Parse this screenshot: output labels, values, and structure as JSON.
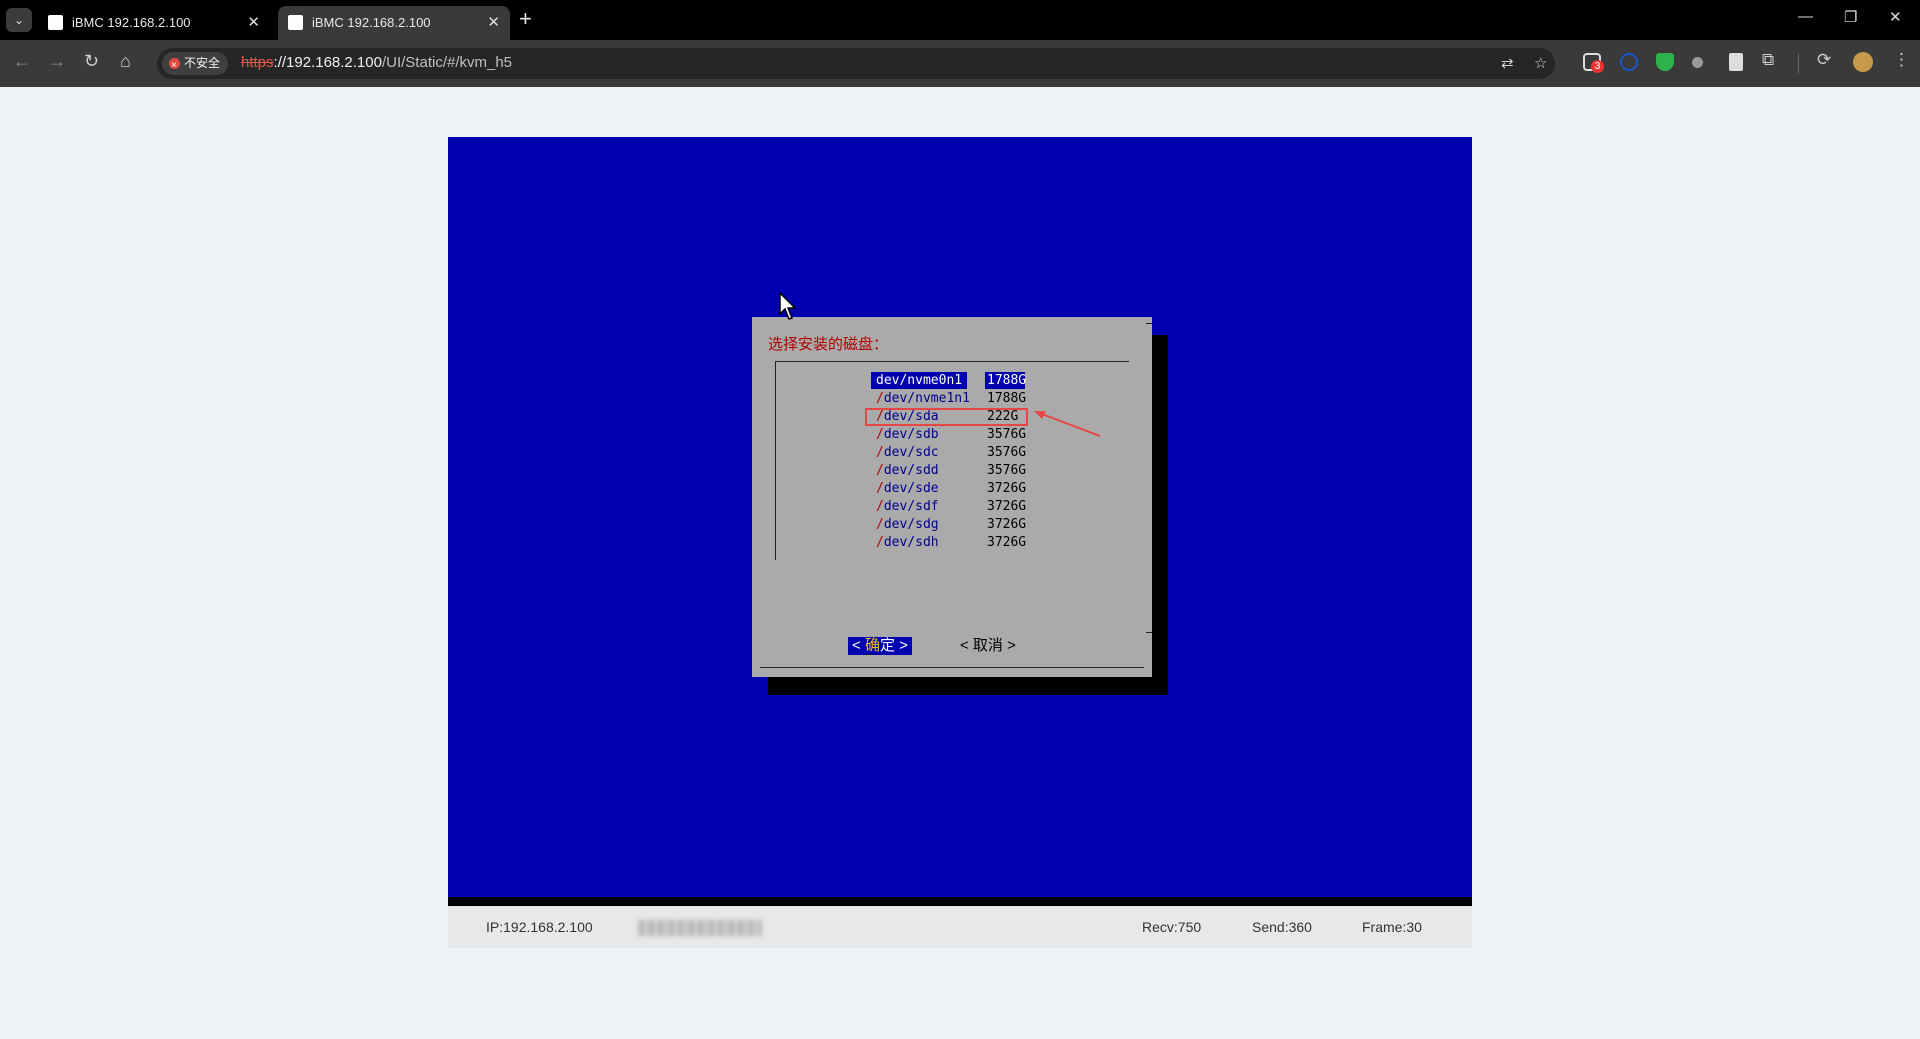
{
  "browser": {
    "tabs": [
      {
        "title": "iBMC 192.168.2.100"
      },
      {
        "title": "iBMC 192.168.2.100"
      }
    ],
    "security_chip": "不安全",
    "url": {
      "scheme": "https",
      "host": "://192.168.2.100",
      "path": "/UI/Static/#/kvm_h5"
    },
    "extension_badge": "3"
  },
  "dialog": {
    "title": "选择安装的磁盘：",
    "disks": [
      {
        "device": "dev/nvme0n1",
        "size": "1788G",
        "selected": true
      },
      {
        "device": "dev/nvme1n1",
        "size": "1788G"
      },
      {
        "device": "dev/sda",
        "size": "222G",
        "highlighted": true
      },
      {
        "device": "dev/sdb",
        "size": "3576G"
      },
      {
        "device": "dev/sdc",
        "size": "3576G"
      },
      {
        "device": "dev/sdd",
        "size": "3576G"
      },
      {
        "device": "dev/sde",
        "size": "3726G"
      },
      {
        "device": "dev/sdf",
        "size": "3726G"
      },
      {
        "device": "dev/sdg",
        "size": "3726G"
      },
      {
        "device": "dev/sdh",
        "size": "3726G"
      }
    ],
    "ok_button": {
      "open": "< ",
      "hotkey": "确",
      "rest": "定",
      "close": " >"
    },
    "cancel_button": "< 取消 >"
  },
  "statusbar": {
    "ip": "IP:192.168.2.100",
    "recv": "Recv:750",
    "send": "Send:360",
    "frame": "Frame:30"
  },
  "colors": {
    "kvm_background": "#0000b0",
    "dialog_background": "#aaaaaa",
    "title_red": "#b00000",
    "annotation_red": "#e84545"
  }
}
